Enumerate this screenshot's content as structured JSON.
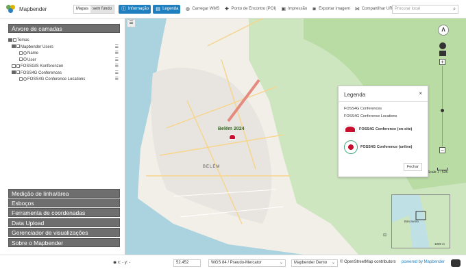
{
  "header": {
    "app_title": "Mapbender",
    "toggle": [
      "Mapas",
      "sem fundo"
    ],
    "tools": [
      "Informação",
      "Legenda",
      "Carregar WMS",
      "Ponto de Encontro (POI)",
      "Impressão",
      "Exportar imagem",
      "Compartilhar URL"
    ],
    "search_placeholder": "Procurar local"
  },
  "sidebar": {
    "layer_tree_title": "Árvore de camadas",
    "tree": [
      "Temas",
      "Mapbender Users",
      "Name",
      "User",
      "FOSSGIS Konferenzen",
      "FOSS4G Conferences",
      "FOSS4G Conference Locations"
    ],
    "panels": [
      "Medição de linha/área",
      "Esboços",
      "Ferramenta de coordenadas",
      "Data Upload",
      "Gerenciador de visualizações",
      "Sobre o Mapbender"
    ]
  },
  "map": {
    "marker_label": "Belém 2024",
    "district_label": "BELÉM",
    "scale_text": "Scale 1 : 52K",
    "overview_scale": "1000 m",
    "overview_labels": [
      "Barcarena"
    ]
  },
  "legend": {
    "title": "Legenda",
    "close": "×",
    "layer1": "FOSS4G Conferences",
    "layer2": "FOSS4G Conference Locations",
    "items": [
      "FOSS4G Conference (on-site)",
      "FOSS4G Conference (online)"
    ],
    "close_button": "Fechar"
  },
  "footer": {
    "coords": "x: - y: -",
    "scale": "52.452",
    "srs": "WGS 84 / Pseudo-Mercator",
    "app": "Mapbender Demo",
    "attribution": "© OpenStreetMap contributors",
    "powered": "powered by Mapbender"
  },
  "colors": {
    "accent": "#1f7fbf",
    "panel": "#6e6e6e",
    "marker": "#c8102e"
  }
}
